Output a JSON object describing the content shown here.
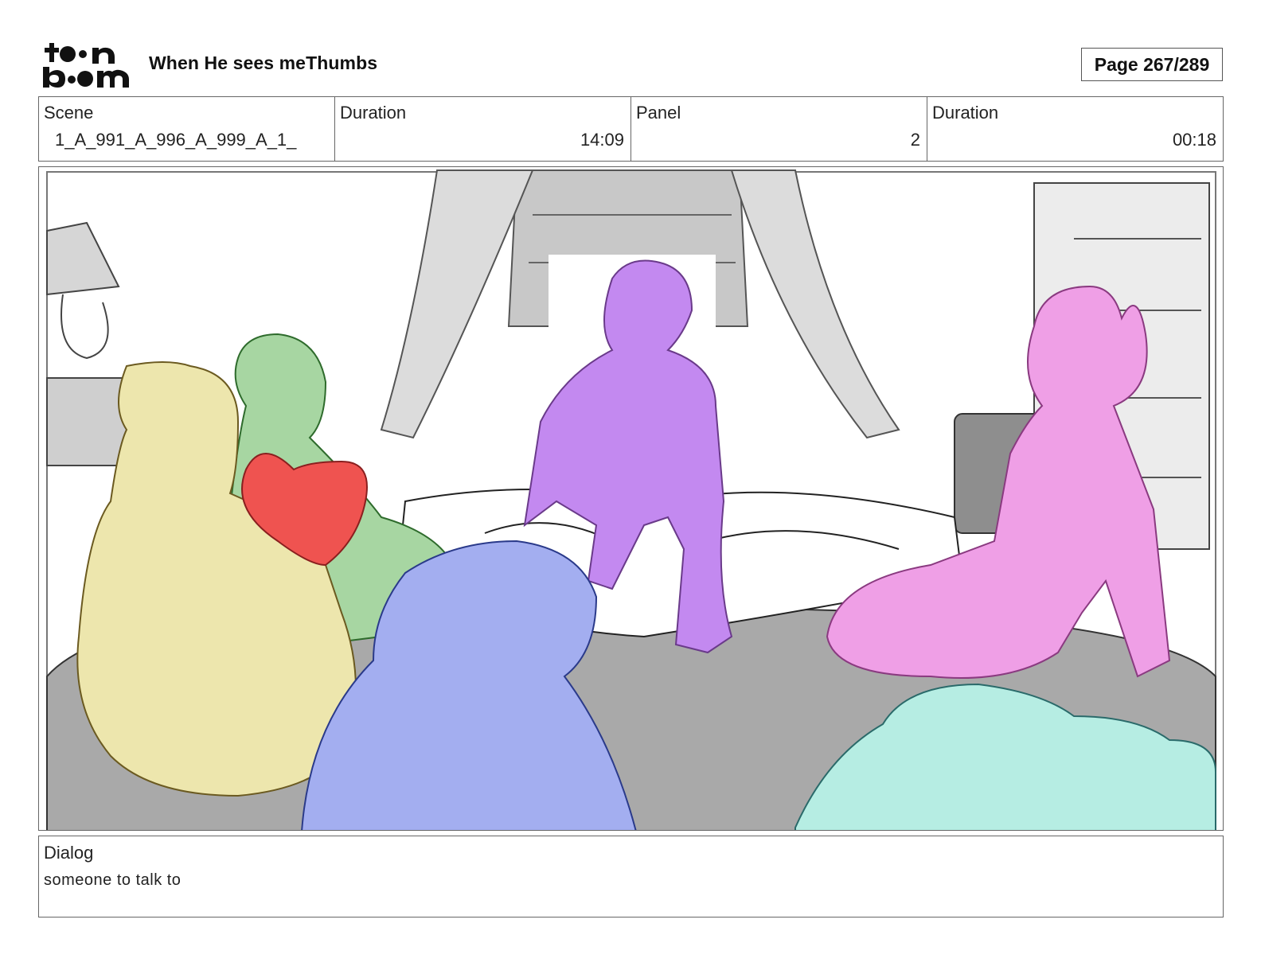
{
  "header": {
    "logo_text": "toon boom",
    "title": "When He sees meThumbs",
    "page": "Page 267/289"
  },
  "info": {
    "scene_label": "Scene",
    "scene_value": "1_A_991_A_996_A_999_A_1_",
    "scene_duration_label": "Duration",
    "scene_duration_value": "14:09",
    "panel_label": "Panel",
    "panel_value": "2",
    "panel_duration_label": "Duration",
    "panel_duration_value": "00:18"
  },
  "panel_image": {
    "colors": {
      "floor": "#a9a9a9",
      "window": "#c8c8c8",
      "yellow_character": "#ede6ad",
      "green_character": "#a7d6a2",
      "heart": "#ef5350",
      "blue_character": "#a3aef0",
      "purple_character": "#c389f0",
      "pink_character": "#ef9fe6",
      "teal_character": "#b6ede3",
      "line": "#333333"
    }
  },
  "dialog": {
    "label": "Dialog",
    "text": "someone to talk to"
  }
}
